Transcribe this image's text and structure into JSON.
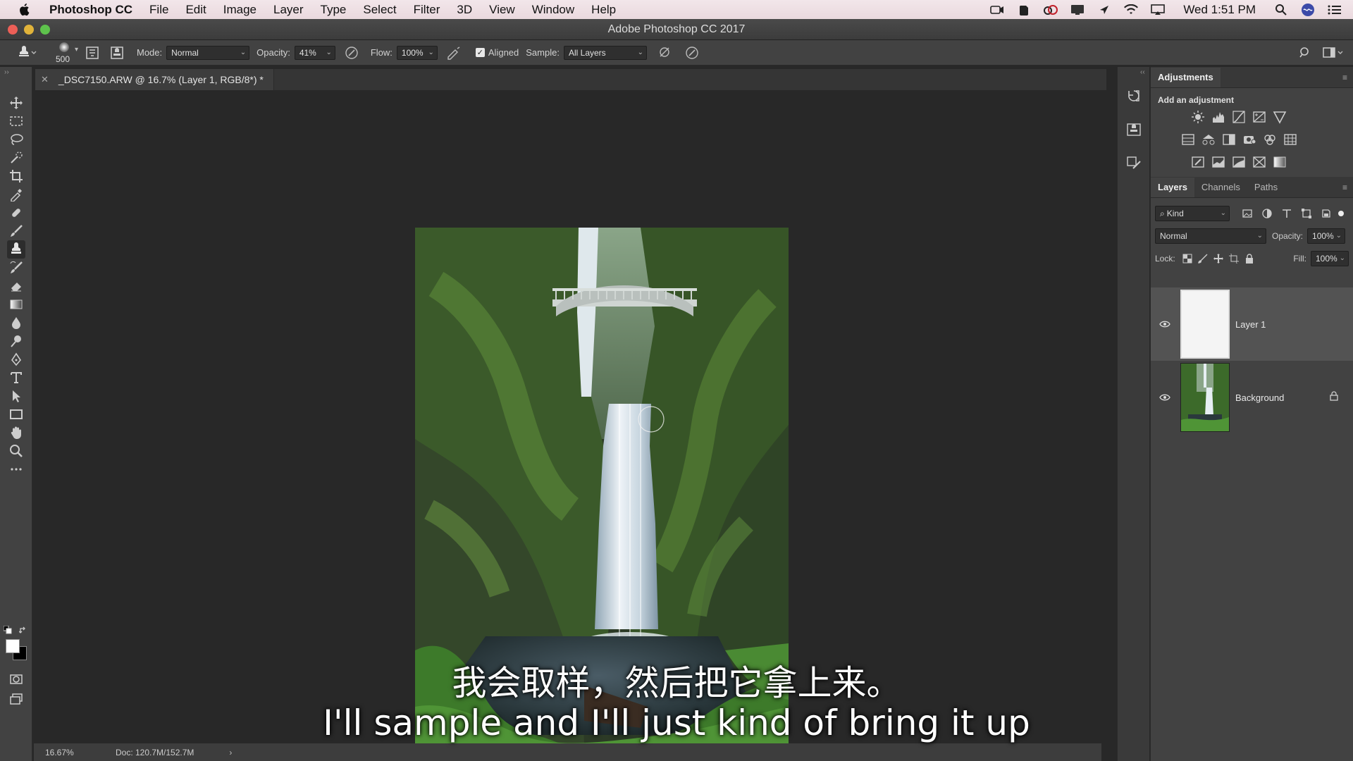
{
  "menubar": {
    "app_name": "Photoshop CC",
    "items": [
      "File",
      "Edit",
      "Image",
      "Layer",
      "Type",
      "Select",
      "Filter",
      "3D",
      "View",
      "Window",
      "Help"
    ],
    "clock": "Wed 1:51 PM"
  },
  "window": {
    "title": "Adobe Photoshop CC 2017"
  },
  "options": {
    "brush_size": "500",
    "mode_label": "Mode:",
    "mode_value": "Normal",
    "opacity_label": "Opacity:",
    "opacity_value": "41%",
    "flow_label": "Flow:",
    "flow_value": "100%",
    "aligned_label": "Aligned",
    "sample_label": "Sample:",
    "sample_value": "All Layers"
  },
  "document": {
    "tab_title": "_DSC7150.ARW @ 16.7% (Layer 1, RGB/8*) *",
    "zoom": "16.67%",
    "doc_size": "Doc: 120.7M/152.7M"
  },
  "captions": {
    "chinese": "我会取样，然后把它拿上来。",
    "english": "I'll sample and I'll just kind of bring it up"
  },
  "adjustments": {
    "tab": "Adjustments",
    "heading": "Add an adjustment"
  },
  "layers_panel": {
    "tabs": [
      "Layers",
      "Channels",
      "Paths"
    ],
    "filter_value": "Kind",
    "blend_mode": "Normal",
    "opacity_label": "Opacity:",
    "opacity_value": "100%",
    "lock_label": "Lock:",
    "fill_label": "Fill:",
    "fill_value": "100%",
    "layers": [
      {
        "name": "Layer 1"
      },
      {
        "name": "Background"
      }
    ]
  },
  "colors": {
    "accent": "#5ec24c",
    "close": "#ec5f57",
    "minimize": "#e1b33a"
  }
}
